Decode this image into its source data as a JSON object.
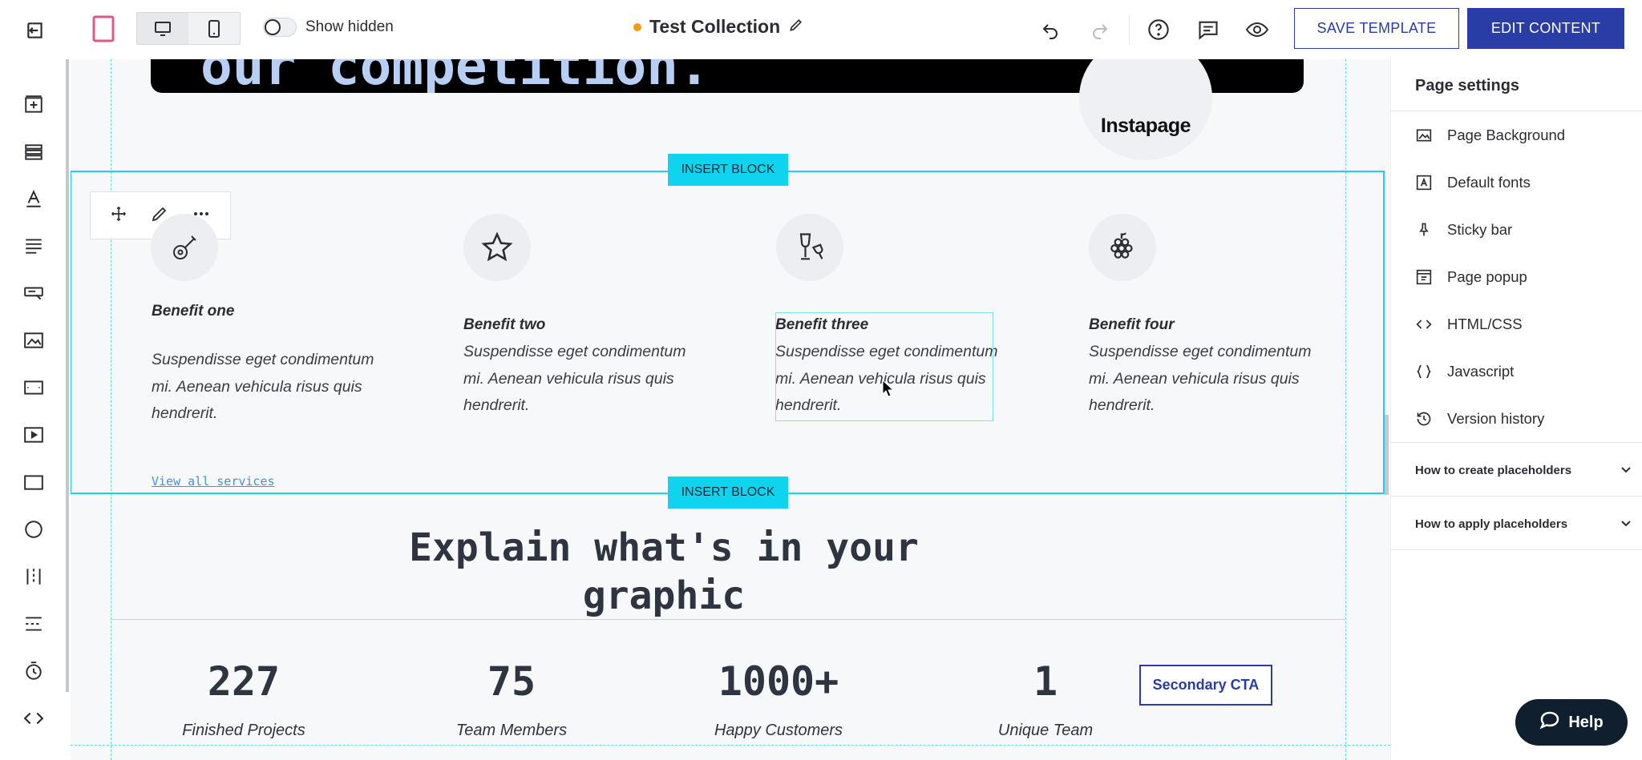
{
  "topbar": {
    "show_hidden_label": "Show hidden",
    "title": "Test Collection",
    "save_template_label": "SAVE TEMPLATE",
    "edit_content_label": "EDIT CONTENT"
  },
  "hero": {
    "headline": "our competition.",
    "badge_logo": "Instapage"
  },
  "insert_block_label": "INSERT BLOCK",
  "benefits": [
    {
      "icon": "guitar-icon",
      "title": "Benefit one",
      "text": "Suspendisse eget condimentum mi. Aenean vehicula risus quis hendrerit."
    },
    {
      "icon": "star-icon",
      "title": "Benefit two",
      "text": "Suspendisse eget condimentum mi. Aenean vehicula risus quis hendrerit."
    },
    {
      "icon": "wine-glasses-icon",
      "title": "Benefit three",
      "text": "Suspendisse eget condimentum mi. Aenean vehicula risus quis hendrerit."
    },
    {
      "icon": "grapes-icon",
      "title": "Benefit four",
      "text": "Suspendisse eget condimentum mi. Aenean vehicula risus quis hendrerit."
    }
  ],
  "view_all_label": "View all services",
  "explain_heading": "Explain what's in your graphic",
  "stats": [
    {
      "value": "227",
      "label": "Finished Projects"
    },
    {
      "value": "75",
      "label": "Team Members"
    },
    {
      "value": "1000+",
      "label": "Happy Customers"
    },
    {
      "value": "1",
      "label": "Unique Team"
    }
  ],
  "secondary_cta_label": "Secondary CTA",
  "page_settings": {
    "title": "Page settings",
    "items": [
      {
        "icon": "image-icon",
        "label": "Page Background"
      },
      {
        "icon": "font-icon",
        "label": "Default fonts"
      },
      {
        "icon": "pin-icon",
        "label": "Sticky bar"
      },
      {
        "icon": "popup-icon",
        "label": "Page popup"
      },
      {
        "icon": "code-icon",
        "label": "HTML/CSS"
      },
      {
        "icon": "braces-icon",
        "label": "Javascript"
      },
      {
        "icon": "history-icon",
        "label": "Version history"
      }
    ],
    "accordions": [
      {
        "label": "How to create placeholders"
      },
      {
        "label": "How to apply placeholders"
      }
    ]
  },
  "help_label": "Help",
  "colors": {
    "accent": "#2a3ca5",
    "insert_block": "#0fd4ef",
    "selection": "#22cfea",
    "status_dot": "#f39c12"
  }
}
